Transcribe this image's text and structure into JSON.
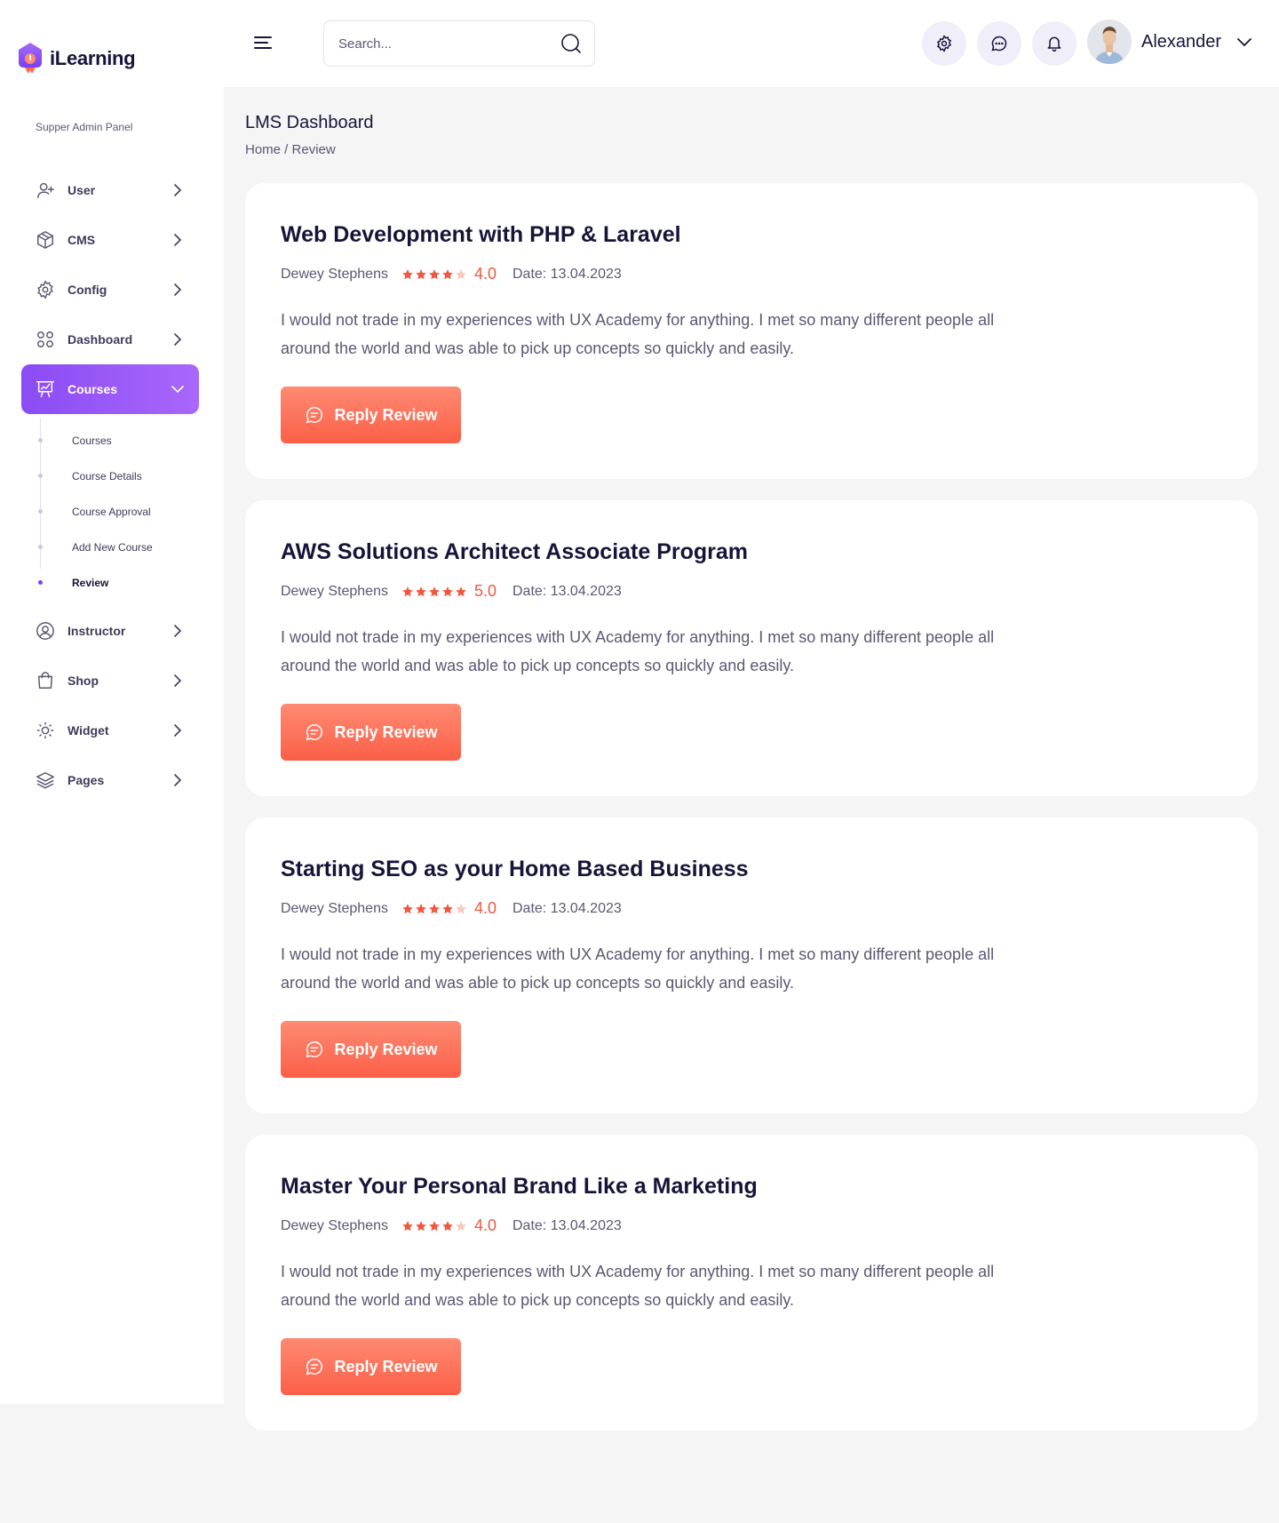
{
  "brand": {
    "name": "iLearning",
    "panel_label": "Supper Admin Panel"
  },
  "colors": {
    "accent": "#8a4cf4",
    "cta": "#fb6a52",
    "star": "#f0573e",
    "text_dark": "#161439",
    "text_muted": "#5a5872",
    "background": "#f5f5f5"
  },
  "sidebar": {
    "items": [
      {
        "label": "User",
        "icon": "user-plus-icon"
      },
      {
        "label": "CMS",
        "icon": "box-icon"
      },
      {
        "label": "Config",
        "icon": "gear-icon"
      },
      {
        "label": "Dashboard",
        "icon": "grid-icon"
      },
      {
        "label": "Courses",
        "icon": "presentation-icon",
        "expanded": true
      },
      {
        "label": "Instructor",
        "icon": "user-circle-icon"
      },
      {
        "label": "Shop",
        "icon": "shopping-bag-icon"
      },
      {
        "label": "Widget",
        "icon": "widget-icon"
      },
      {
        "label": "Pages",
        "icon": "layers-icon"
      }
    ],
    "courses_subitems": [
      {
        "label": "Courses"
      },
      {
        "label": "Course Details"
      },
      {
        "label": "Course Approval"
      },
      {
        "label": "Add New Course"
      },
      {
        "label": "Review",
        "active": true
      }
    ]
  },
  "header": {
    "search_placeholder": "Search...",
    "user_name": "Alexander"
  },
  "page": {
    "title": "LMS Dashboard",
    "breadcrumb": {
      "home": "Home",
      "separator": " / ",
      "current": "Review"
    }
  },
  "reviews": [
    {
      "title": "Web Development with PHP & Laravel",
      "author": "Dewey Stephens",
      "rating": 4,
      "score": "4.0",
      "date": "Date: 13.04.2023",
      "text": "I would not trade in my experiences with UX Academy for anything. I met so many different people all around the world and was able to pick up concepts so quickly and easily.",
      "button": "Reply Review"
    },
    {
      "title": "AWS Solutions Architect Associate Program",
      "author": "Dewey Stephens",
      "rating": 5,
      "score": "5.0",
      "date": "Date: 13.04.2023",
      "text": "I would not trade in my experiences with UX Academy for anything. I met so many different people all around the world and was able to pick up concepts so quickly and easily.",
      "button": "Reply Review"
    },
    {
      "title": "Starting SEO as your Home Based Business",
      "author": "Dewey Stephens",
      "rating": 4,
      "score": "4.0",
      "date": "Date: 13.04.2023",
      "text": "I would not trade in my experiences with UX Academy for anything. I met so many different people all around the world and was able to pick up concepts so quickly and easily.",
      "button": "Reply Review"
    },
    {
      "title": "Master Your Personal Brand Like a Marketing",
      "author": "Dewey Stephens",
      "rating": 4,
      "score": "4.0",
      "date": "Date: 13.04.2023",
      "text": "I would not trade in my experiences with UX Academy for anything. I met so many different people all around the world and was able to pick up concepts so quickly and easily.",
      "button": "Reply Review"
    }
  ]
}
